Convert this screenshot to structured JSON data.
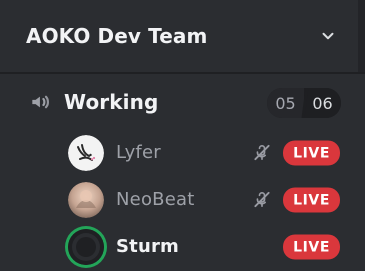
{
  "server": {
    "name": "AOKO Dev Team",
    "chevron_icon": "chevron-down-icon"
  },
  "channel": {
    "name": "Working",
    "icon": "speaker-icon",
    "count_current": "05",
    "count_limit": "06"
  },
  "users": [
    {
      "name": "Lyfer",
      "avatar_icon": "bunny-avatar",
      "muted_icon": "mic-off-icon",
      "badge": "LIVE",
      "active": false
    },
    {
      "name": "NeoBeat",
      "avatar_icon": "photo-avatar",
      "muted_icon": "mic-off-icon",
      "badge": "LIVE",
      "active": false
    },
    {
      "name": "Sturm",
      "avatar_icon": "ring-avatar",
      "muted_icon": "",
      "badge": "LIVE",
      "active": true
    }
  ],
  "colors": {
    "bg": "#2b2d31",
    "header_divider": "#1f2023",
    "live": "#da373c",
    "speaking_ring": "#23a559",
    "text_primary": "#f2f3f5",
    "text_muted": "#9ea1a8"
  }
}
